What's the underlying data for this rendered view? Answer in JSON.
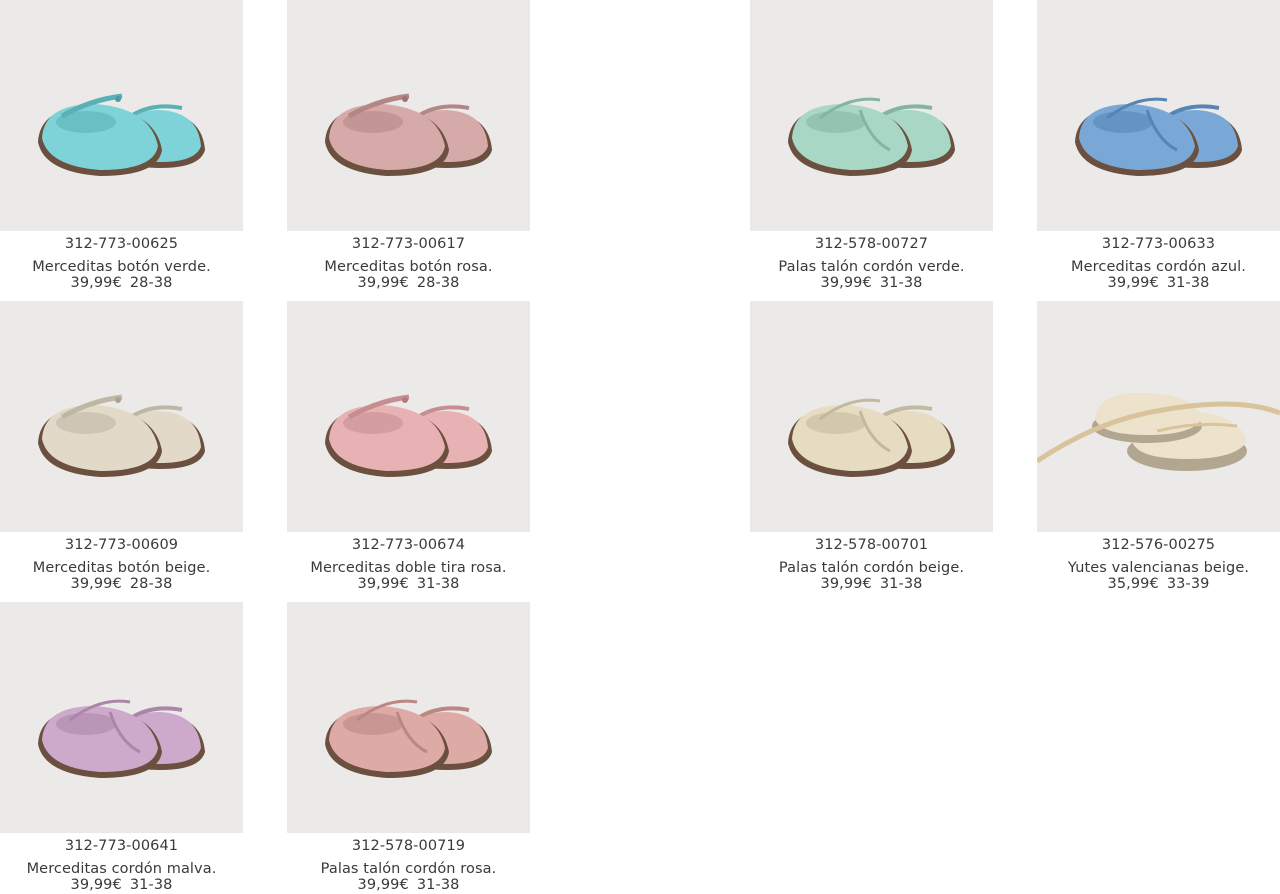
{
  "products": [
    {
      "code": "312-773-00625",
      "name": "Merceditas botón verde.",
      "price": "39,99€",
      "sizes": "28-38",
      "color": "#7ed3d8",
      "style": "button"
    },
    {
      "code": "312-773-00617",
      "name": "Merceditas botón rosa.",
      "price": "39,99€",
      "sizes": "28-38",
      "color": "#d6aaa8",
      "style": "button"
    },
    {
      "code": "312-578-00727",
      "name": "Palas talón cordón verde.",
      "price": "39,99€",
      "sizes": "31-38",
      "color": "#a9d7c5",
      "style": "lace"
    },
    {
      "code": "312-773-00633",
      "name": "Merceditas cordón azul.",
      "price": "39,99€",
      "sizes": "31-38",
      "color": "#7aa8d6",
      "style": "lace"
    },
    {
      "code": "312-773-00609",
      "name": "Merceditas botón beige.",
      "price": "39,99€",
      "sizes": "28-38",
      "color": "#e3d9c8",
      "style": "button"
    },
    {
      "code": "312-773-00674",
      "name": "Merceditas doble tira rosa.",
      "price": "39,99€",
      "sizes": "31-38",
      "color": "#e8b2b4",
      "style": "button"
    },
    {
      "code": "312-578-00701",
      "name": "Palas talón cordón beige.",
      "price": "39,99€",
      "sizes": "31-38",
      "color": "#e6dcc1",
      "style": "lace"
    },
    {
      "code": "312-576-00275",
      "name": "Yutes valencianas beige.",
      "price": "35,99€",
      "sizes": "33-39",
      "color": "#ede2cc",
      "style": "espadrille"
    },
    {
      "code": "312-773-00641",
      "name": "Merceditas cordón malva.",
      "price": "39,99€",
      "sizes": "31-38",
      "color": "#cda9cc",
      "style": "lace"
    },
    {
      "code": "312-578-00719",
      "name": "Palas talón cordón rosa.",
      "price": "39,99€",
      "sizes": "31-38",
      "color": "#deaaa6",
      "style": "lace"
    }
  ],
  "flag_icon": "spain-flag-icon",
  "colors": {
    "photo_bg": "#ebeae8",
    "text": "#3a3a3a",
    "sole": "#6b4f3f"
  }
}
